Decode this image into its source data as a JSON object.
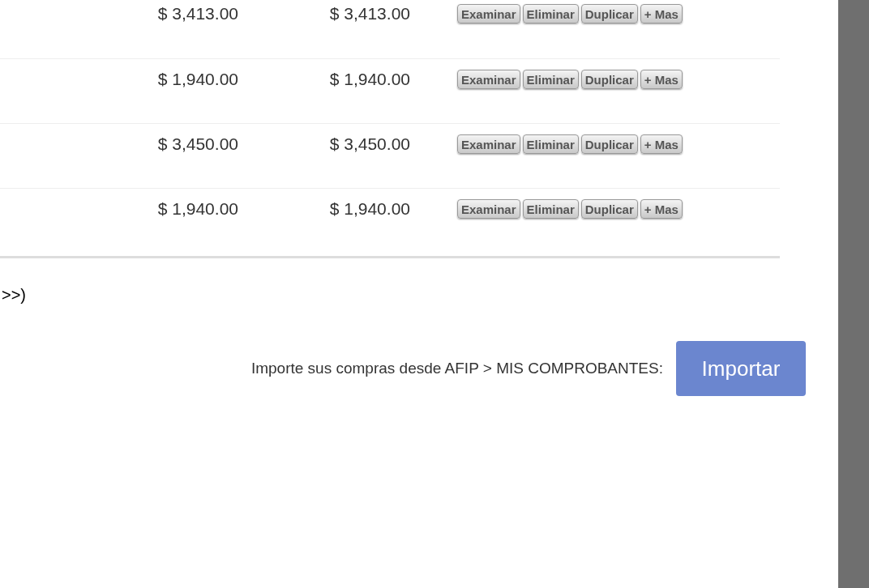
{
  "table": {
    "rows": [
      {
        "amount_1": "$ 3,413.00",
        "amount_2": "$ 3,413.00",
        "actions": [
          "Examinar",
          "Eliminar",
          "Duplicar",
          "+ Mas"
        ]
      },
      {
        "amount_1": "$ 1,940.00",
        "amount_2": "$ 1,940.00",
        "actions": [
          "Examinar",
          "Eliminar",
          "Duplicar",
          "+ Mas"
        ]
      },
      {
        "amount_1": "$ 3,450.00",
        "amount_2": "$ 3,450.00",
        "actions": [
          "Examinar",
          "Eliminar",
          "Duplicar",
          "+ Mas"
        ]
      },
      {
        "amount_1": "$ 1,940.00",
        "amount_2": "$ 1,940.00",
        "actions": [
          "Examinar",
          "Eliminar",
          "Duplicar",
          "+ Mas"
        ]
      }
    ]
  },
  "pagination_text": ">>)",
  "import": {
    "label": "Importe sus compras desde AFIP > MIS COMPROBANTES:",
    "button": "Importar"
  }
}
